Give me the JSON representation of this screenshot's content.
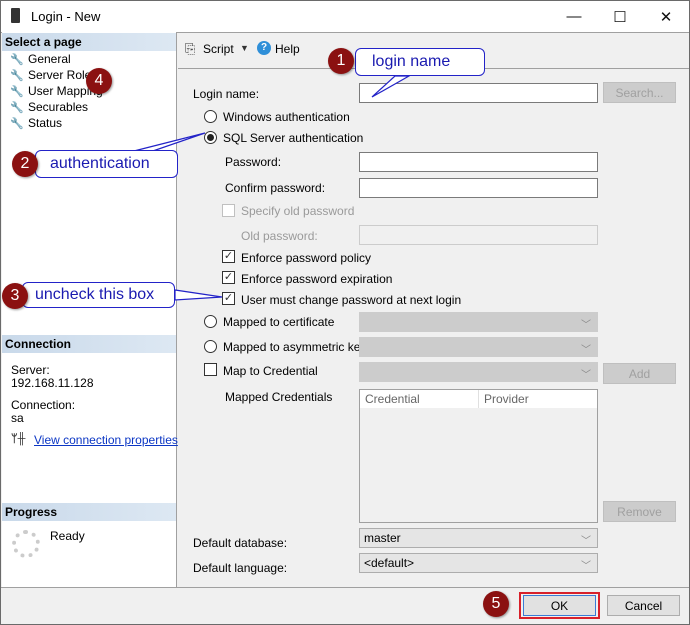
{
  "window": {
    "title": "Login - New",
    "minimize_glyph": "—",
    "maximize_glyph": "☐",
    "close_glyph": "✕"
  },
  "sidebar": {
    "select_page_header": "Select a page",
    "pages": [
      {
        "label": "General",
        "icon": "wrench-icon"
      },
      {
        "label": "Server Roles",
        "icon": "wrench-icon"
      },
      {
        "label": "User Mapping",
        "icon": "wrench-icon"
      },
      {
        "label": "Securables",
        "icon": "wrench-icon"
      },
      {
        "label": "Status",
        "icon": "wrench-icon"
      }
    ],
    "connection_header": "Connection",
    "server_label": "Server:",
    "server_value": "192.168.11.128",
    "connection_label": "Connection:",
    "connection_value": "sa",
    "view_connection_link": "View connection properties",
    "progress_header": "Progress",
    "progress_status": "Ready"
  },
  "toolbar": {
    "script_label": "Script",
    "help_label": "Help"
  },
  "form": {
    "login_name_label": "Login name:",
    "login_name_value": "",
    "search_button": "Search...",
    "windows_auth_label": "Windows authentication",
    "windows_auth_selected": false,
    "sql_auth_label": "SQL Server authentication",
    "sql_auth_selected": true,
    "password_label": "Password:",
    "confirm_password_label": "Confirm password:",
    "specify_old_password_label": "Specify old password",
    "specify_old_password_checked": false,
    "old_password_label": "Old password:",
    "enforce_policy_label": "Enforce password policy",
    "enforce_policy_checked": true,
    "enforce_expiration_label": "Enforce password expiration",
    "enforce_expiration_checked": true,
    "must_change_label": "User must change password at next login",
    "must_change_checked": true,
    "mapped_cert_label": "Mapped to certificate",
    "mapped_asym_label": "Mapped to asymmetric key",
    "map_credential_label": "Map to Credential",
    "add_button": "Add",
    "mapped_credentials_label": "Mapped Credentials",
    "credentials_columns": [
      "Credential",
      "Provider"
    ],
    "remove_button": "Remove",
    "default_database_label": "Default database:",
    "default_database_value": "master",
    "default_language_label": "Default language:",
    "default_language_value": "<default>"
  },
  "footer": {
    "ok_button": "OK",
    "cancel_button": "Cancel"
  },
  "annotations": [
    {
      "number": "1",
      "text": "login name"
    },
    {
      "number": "2",
      "text": "authentication"
    },
    {
      "number": "3",
      "text": "uncheck this box"
    },
    {
      "number": "4",
      "text": ""
    },
    {
      "number": "5",
      "text": ""
    }
  ],
  "colors": {
    "badge": "#8b1111",
    "callout_text": "#1a1ab0",
    "callout_border": "#2323c8",
    "ok_highlight": "#d8202a",
    "link": "#0b36c4"
  }
}
